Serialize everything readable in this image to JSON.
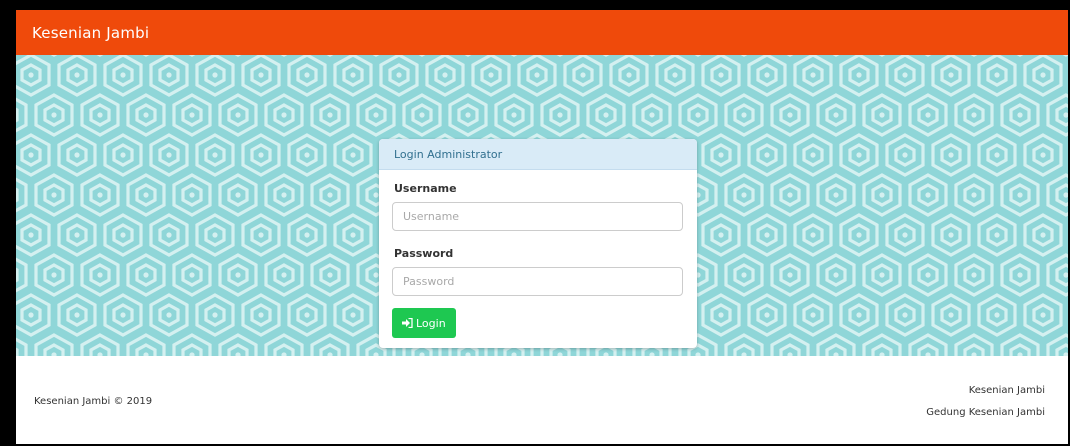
{
  "navbar": {
    "brand": "Kesenian Jambi"
  },
  "login_panel": {
    "heading": "Login Administrator",
    "username_label": "Username",
    "username_placeholder": "Username",
    "username_value": "",
    "password_label": "Password",
    "password_placeholder": "Password",
    "password_value": "",
    "login_button_label": "Login",
    "login_icon": "sign-in-icon"
  },
  "footer": {
    "copyright": "Kesenian Jambi © 2019",
    "right_line_1": "Kesenian Jambi",
    "right_line_2": "Gedung Kesenian Jambi"
  },
  "colors": {
    "navbar": "#ef4a0b",
    "pattern_background": "#8fd6d8",
    "pattern_lines": "#d4f0f0",
    "panel_heading": "#d9ebf7",
    "login_button": "#1ec851"
  }
}
